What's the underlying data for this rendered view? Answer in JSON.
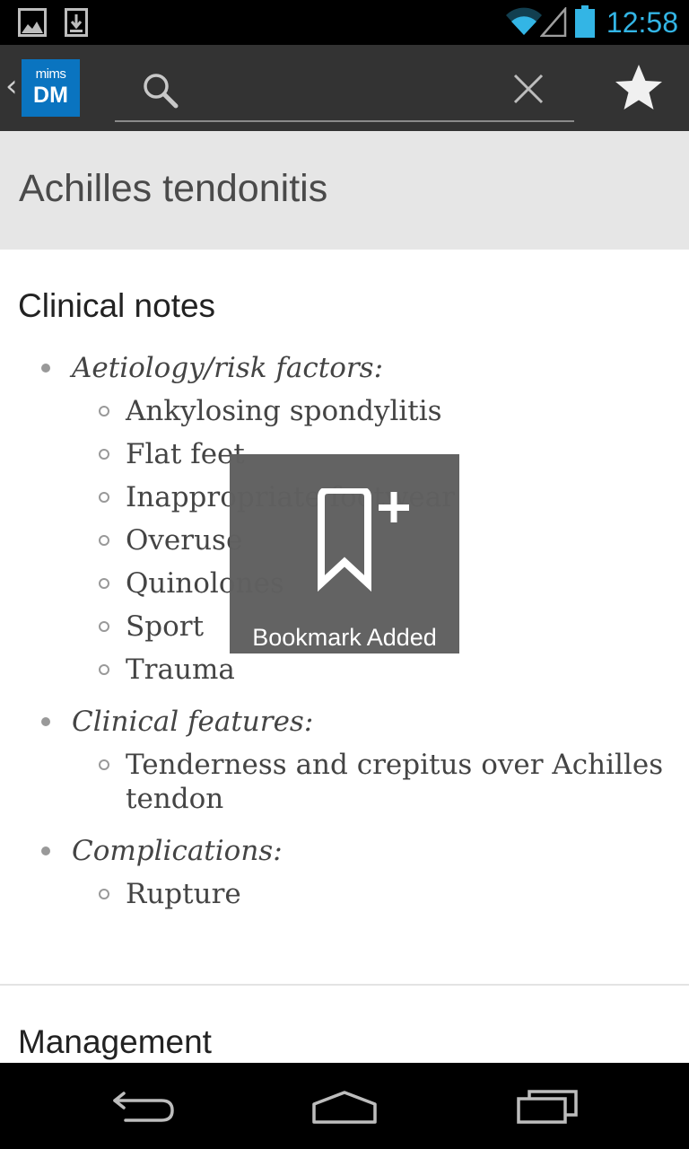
{
  "status_bar": {
    "time": "12:58",
    "colors": {
      "accent": "#33b5e5"
    },
    "icons": [
      "gallery-notification-icon",
      "download-notification-icon",
      "wifi-icon",
      "cell-signal-icon",
      "battery-icon"
    ]
  },
  "action_bar": {
    "logo": {
      "top_text": "mims",
      "main_text": "DM"
    },
    "search": {
      "value": "",
      "placeholder": ""
    },
    "icons": [
      "up-caret-icon",
      "search-icon",
      "close-icon",
      "star-icon"
    ]
  },
  "page": {
    "title": "Achilles tendonitis"
  },
  "content": {
    "clinical_notes": {
      "heading": "Clinical notes",
      "groups": [
        {
          "label": "Aetiology/risk factors:",
          "items": [
            "Ankylosing spondylitis",
            "Flat feet",
            "Inappropriate footwear",
            "Overuse",
            "Quinolones",
            "Sport",
            "Trauma"
          ]
        },
        {
          "label": "Clinical features:",
          "items": [
            "Tenderness and crepitus over Achilles",
            "tendon"
          ]
        },
        {
          "label": "Complications:",
          "items": [
            "Rupture"
          ]
        }
      ]
    },
    "management": {
      "heading": "Management"
    }
  },
  "toast": {
    "text": "Bookmark Added",
    "icon": "bookmark-add-icon"
  },
  "nav_bar": {
    "icons": [
      "back-icon",
      "home-icon",
      "recent-apps-icon"
    ]
  }
}
